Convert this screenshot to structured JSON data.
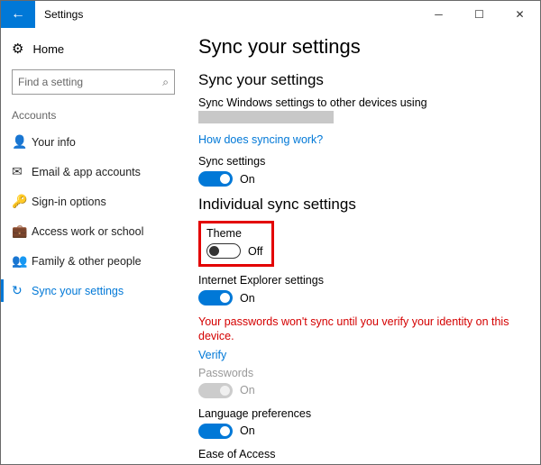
{
  "window": {
    "title": "Settings"
  },
  "sidebar": {
    "home": "Home",
    "search_placeholder": "Find a setting",
    "section": "Accounts",
    "items": [
      {
        "label": "Your info"
      },
      {
        "label": "Email & app accounts"
      },
      {
        "label": "Sign-in options"
      },
      {
        "label": "Access work or school"
      },
      {
        "label": "Family & other people"
      },
      {
        "label": "Sync your settings"
      }
    ]
  },
  "content": {
    "page_title": "Sync your settings",
    "section1_heading": "Sync your settings",
    "sync_desc": "Sync Windows settings to other devices using",
    "how_link": "How does syncing work?",
    "sync_settings": {
      "label": "Sync settings",
      "state": "On"
    },
    "section2_heading": "Individual sync settings",
    "theme": {
      "label": "Theme",
      "state": "Off"
    },
    "ie": {
      "label": "Internet Explorer settings",
      "state": "On"
    },
    "warning": "Your passwords won't sync until you verify your identity on this device.",
    "verify_link": "Verify",
    "passwords": {
      "label": "Passwords",
      "state": "On"
    },
    "language": {
      "label": "Language preferences",
      "state": "On"
    },
    "ease": {
      "label": "Ease of Access"
    }
  }
}
